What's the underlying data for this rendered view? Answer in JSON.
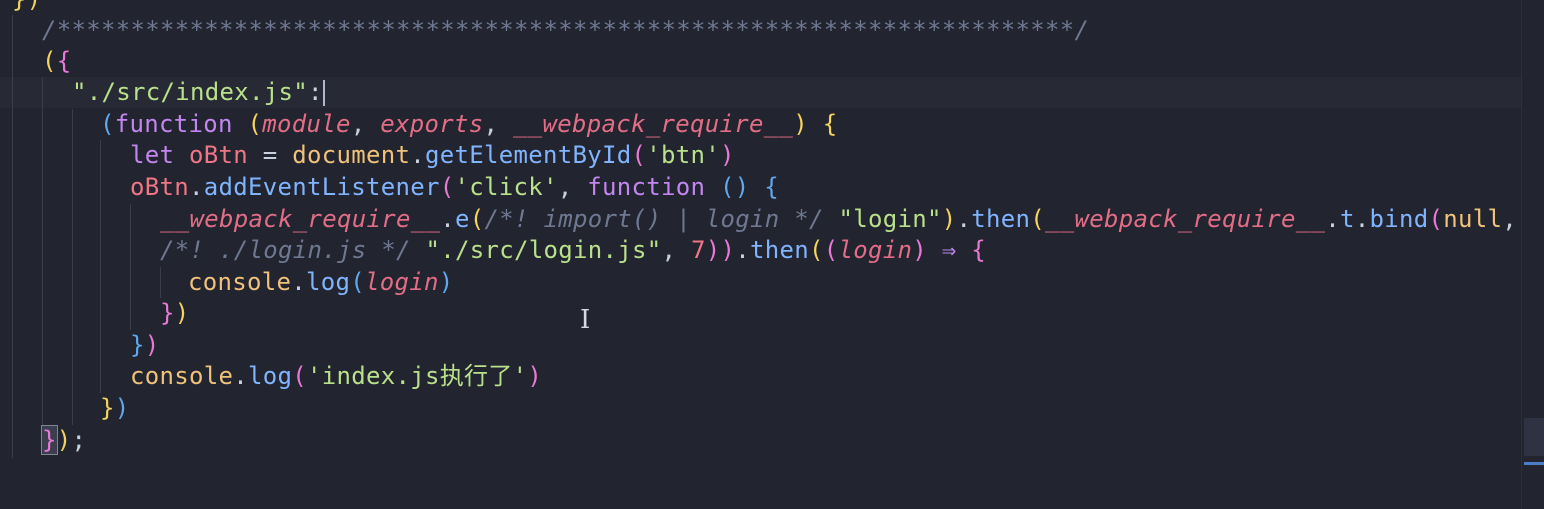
{
  "editor": {
    "lines": [
      {
        "tokens": [
          {
            "t": "})",
            "c": "p-yellow"
          }
        ]
      },
      {
        "tokens": [
          {
            "t": "/*********************************************************************/",
            "c": "c-comment"
          }
        ]
      },
      {
        "tokens": [
          {
            "t": "(",
            "c": "p-yellow"
          },
          {
            "t": "{",
            "c": "p-pink"
          }
        ]
      },
      {
        "tokens": [
          {
            "t": "\"./src/index.js\"",
            "c": "c-str"
          },
          {
            "t": ":",
            "c": "c-punc"
          }
        ]
      },
      {
        "tokens": [
          {
            "t": "(",
            "c": "p-blue"
          },
          {
            "t": "function",
            "c": "c-kw"
          },
          {
            "t": " ",
            "c": "c-punc"
          },
          {
            "t": "(",
            "c": "p-yellow"
          },
          {
            "t": "module",
            "c": "c-param"
          },
          {
            "t": ", ",
            "c": "c-punc"
          },
          {
            "t": "exports",
            "c": "c-param"
          },
          {
            "t": ", ",
            "c": "c-punc"
          },
          {
            "t": "__webpack_require__",
            "c": "c-param"
          },
          {
            "t": ")",
            "c": "p-yellow"
          },
          {
            "t": " ",
            "c": "c-punc"
          },
          {
            "t": "{",
            "c": "p-yellow"
          }
        ]
      },
      {
        "tokens": [
          {
            "t": "let",
            "c": "c-kw"
          },
          {
            "t": " ",
            "c": "c-punc"
          },
          {
            "t": "oBtn",
            "c": "c-var"
          },
          {
            "t": " = ",
            "c": "c-punc"
          },
          {
            "t": "document",
            "c": "c-obj"
          },
          {
            "t": ".",
            "c": "c-punc"
          },
          {
            "t": "getElementById",
            "c": "c-fn"
          },
          {
            "t": "(",
            "c": "p-pink"
          },
          {
            "t": "'btn'",
            "c": "c-str"
          },
          {
            "t": ")",
            "c": "p-pink"
          }
        ]
      },
      {
        "tokens": [
          {
            "t": "oBtn",
            "c": "c-var"
          },
          {
            "t": ".",
            "c": "c-punc"
          },
          {
            "t": "addEventListener",
            "c": "c-fn"
          },
          {
            "t": "(",
            "c": "p-pink"
          },
          {
            "t": "'click'",
            "c": "c-str"
          },
          {
            "t": ", ",
            "c": "c-punc"
          },
          {
            "t": "function",
            "c": "c-kw"
          },
          {
            "t": " ",
            "c": "c-punc"
          },
          {
            "t": "()",
            "c": "p-blue"
          },
          {
            "t": " ",
            "c": "c-punc"
          },
          {
            "t": "{",
            "c": "p-blue"
          }
        ]
      },
      {
        "tokens": [
          {
            "t": "__webpack_require__",
            "c": "c-param"
          },
          {
            "t": ".",
            "c": "c-punc"
          },
          {
            "t": "e",
            "c": "c-fn"
          },
          {
            "t": "(",
            "c": "p-yellow"
          },
          {
            "t": "/*! import() | login */",
            "c": "c-comment"
          },
          {
            "t": " ",
            "c": "c-punc"
          },
          {
            "t": "\"login\"",
            "c": "c-str"
          },
          {
            "t": ")",
            "c": "p-yellow"
          },
          {
            "t": ".",
            "c": "c-punc"
          },
          {
            "t": "then",
            "c": "c-fn"
          },
          {
            "t": "(",
            "c": "p-yellow"
          },
          {
            "t": "__webpack_require__",
            "c": "c-param"
          },
          {
            "t": ".",
            "c": "c-punc"
          },
          {
            "t": "t",
            "c": "c-fn"
          },
          {
            "t": ".",
            "c": "c-punc"
          },
          {
            "t": "bind",
            "c": "c-fn"
          },
          {
            "t": "(",
            "c": "p-pink"
          },
          {
            "t": "null",
            "c": "c-obj"
          },
          {
            "t": ",",
            "c": "c-punc"
          }
        ]
      },
      {
        "tokens": [
          {
            "t": "/*! ./login.js */",
            "c": "c-comment"
          },
          {
            "t": " ",
            "c": "c-punc"
          },
          {
            "t": "\"./src/login.js\"",
            "c": "c-str"
          },
          {
            "t": ", ",
            "c": "c-punc"
          },
          {
            "t": "7",
            "c": "c-var"
          },
          {
            "t": "))",
            "c": "p-pink"
          },
          {
            "t": ".",
            "c": "c-punc"
          },
          {
            "t": "then",
            "c": "c-fn"
          },
          {
            "t": "(",
            "c": "p-yellow"
          },
          {
            "t": "(",
            "c": "p-pink"
          },
          {
            "t": "login",
            "c": "c-param"
          },
          {
            "t": ")",
            "c": "p-pink"
          },
          {
            "t": " ⇒ ",
            "c": "c-kw"
          },
          {
            "t": "{",
            "c": "p-pink"
          }
        ]
      },
      {
        "tokens": [
          {
            "t": "console",
            "c": "c-obj"
          },
          {
            "t": ".",
            "c": "c-punc"
          },
          {
            "t": "log",
            "c": "c-fn"
          },
          {
            "t": "(",
            "c": "p-blue"
          },
          {
            "t": "login",
            "c": "c-param"
          },
          {
            "t": ")",
            "c": "p-blue"
          }
        ]
      },
      {
        "tokens": [
          {
            "t": "}",
            "c": "p-pink"
          },
          {
            "t": ")",
            "c": "p-yellow"
          }
        ]
      },
      {
        "tokens": [
          {
            "t": "}",
            "c": "p-blue"
          },
          {
            "t": ")",
            "c": "p-pink"
          }
        ]
      },
      {
        "tokens": [
          {
            "t": "console",
            "c": "c-obj"
          },
          {
            "t": ".",
            "c": "c-punc"
          },
          {
            "t": "log",
            "c": "c-fn"
          },
          {
            "t": "(",
            "c": "p-pink"
          },
          {
            "t": "'index.js执行了'",
            "c": "c-str"
          },
          {
            "t": ")",
            "c": "p-pink"
          }
        ]
      },
      {
        "tokens": [
          {
            "t": "}",
            "c": "p-yellow"
          },
          {
            "t": ")",
            "c": "p-blue"
          }
        ]
      },
      {
        "tokens": [
          {
            "t": "}",
            "c": "p-pink bracket-box"
          },
          {
            "t": ")",
            "c": "p-yellow"
          },
          {
            "t": ";",
            "c": "c-punc"
          }
        ]
      }
    ]
  }
}
